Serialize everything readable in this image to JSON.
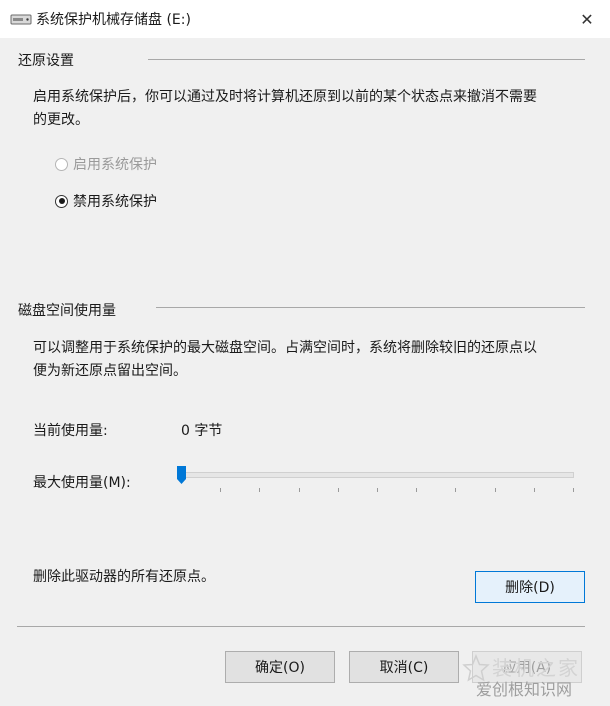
{
  "window": {
    "title": "系统保护机械存储盘 (E:)",
    "close_glyph": "✕",
    "icon": "drive-icon"
  },
  "restore": {
    "group_label": "还原设置",
    "description_line1": "启用系统保护后，你可以通过及时将计算机还原到以前的某个状态点来撤消不需要",
    "description_line2": "的更改。",
    "radio_enable": "启用系统保护",
    "radio_disable": "禁用系统保护",
    "selected": "disable"
  },
  "disk": {
    "group_label": "磁盘空间使用量",
    "description_line1": "可以调整用于系统保护的最大磁盘空间。占满空间时，系统将删除较旧的还原点以",
    "description_line2": "便为新还原点留出空间。",
    "current_usage_label": "当前使用量:",
    "current_usage_value": "0 字节",
    "max_usage_label": "最大使用量(M):",
    "max_usage_fraction": 0,
    "accent_color": "#0078d7"
  },
  "delete": {
    "label": "删除此驱动器的所有还原点。",
    "button": "删除(D)"
  },
  "footer": {
    "ok_button": "确定(O)",
    "cancel_button": "取消(C)",
    "apply_button": "应用(A)"
  },
  "watermark": {
    "top_text": "装机之家",
    "bottom_text": "爱创根知识网"
  }
}
